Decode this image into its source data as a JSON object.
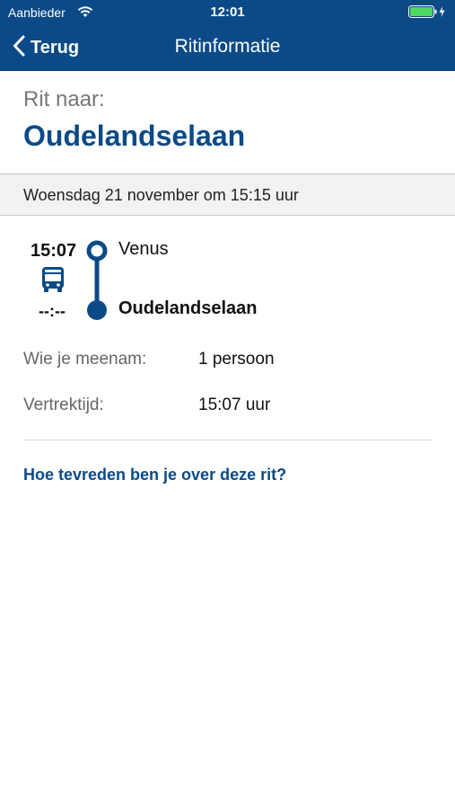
{
  "statusbar": {
    "carrier": "Aanbieder",
    "time": "12:01"
  },
  "navbar": {
    "back_label": "Terug",
    "title": "Ritinformatie"
  },
  "destination": {
    "label": "Rit naar:",
    "name": "Oudelandselaan"
  },
  "date": "Woensdag 21 november om 15:15 uur",
  "route": {
    "departure_time": "15:07",
    "arrival_time": "--:--",
    "from": "Venus",
    "to": "Oudelandselaan"
  },
  "details": {
    "passengers_label": "Wie je meenam:",
    "passengers_value": "1 persoon",
    "departure_label": "Vertrektijd:",
    "departure_value": "15:07 uur"
  },
  "feedback_link": "Hoe tevreden ben je over deze rit?",
  "colors": {
    "brand_blue": "#0b4a87",
    "band_gray": "#f2f2f2",
    "battery_green": "#4cd964"
  },
  "icons": [
    "wifi-icon",
    "battery-icon",
    "back-chevron-icon",
    "bus-icon",
    "route-line-icon"
  ]
}
